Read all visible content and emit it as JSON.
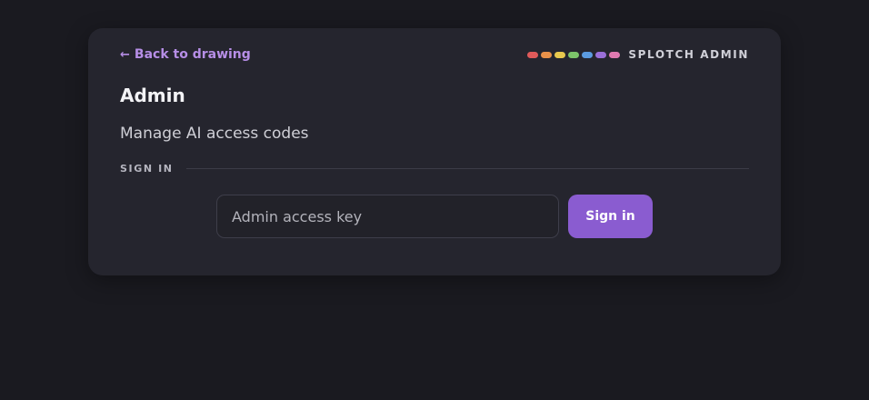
{
  "nav": {
    "back_arrow": "←",
    "back_label": "Back to drawing"
  },
  "brand": {
    "label": "SPLOTCH ADMIN",
    "dot_colors": [
      "#e05a5a",
      "#e8914a",
      "#e8c84e",
      "#7cc46a",
      "#5b9be0",
      "#9a6fd8",
      "#e07ab0"
    ]
  },
  "header": {
    "title": "Admin",
    "subtitle": "Manage AI access codes"
  },
  "signin": {
    "section_label": "SIGN IN",
    "key_placeholder": "Admin access key",
    "key_value": "",
    "button_label": "Sign in"
  },
  "colors": {
    "accent": "#8a5cd0",
    "link": "#b68ee6",
    "background": "#1a1a20",
    "card": "#25252e"
  }
}
